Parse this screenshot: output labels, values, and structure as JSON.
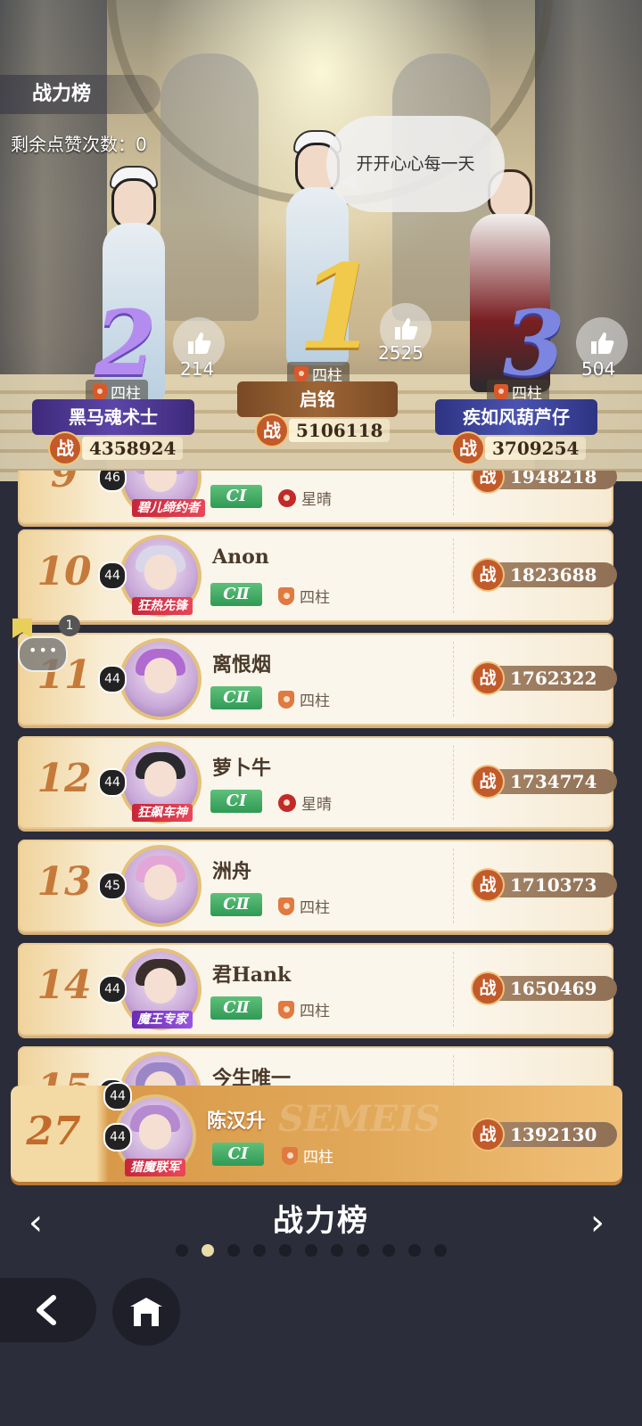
{
  "header": {
    "title": "战力榜",
    "likes_remaining": "剩余点赞次数：0"
  },
  "top3": [
    {
      "rank": "1",
      "name": "启铭",
      "guild": "四柱",
      "power": "5106118",
      "likes": "2525",
      "speech": "开开心心每一天"
    },
    {
      "rank": "2",
      "name": "黑马魂术士",
      "guild": "四柱",
      "power": "4358924",
      "likes": "214"
    },
    {
      "rank": "3",
      "name": "疾如风葫芦仔",
      "guild": "四柱",
      "power": "3709254",
      "likes": "504"
    }
  ],
  "power_glyph": "战",
  "list": [
    {
      "rank": "9",
      "level": "46",
      "title": "碧儿缔约者",
      "tier": "CⅠ",
      "guild": "星晴",
      "guild_icon": "fire-icon",
      "power": "1948218",
      "name": ""
    },
    {
      "rank": "10",
      "level": "44",
      "title": "狂热先锋",
      "name": "Anon",
      "tier": "CⅡ",
      "guild": "四柱",
      "guild_icon": "shield-icon",
      "power": "1823688"
    },
    {
      "rank": "11",
      "level": "44",
      "title": "",
      "name": "离恨烟",
      "tier": "CⅡ",
      "guild": "四柱",
      "guild_icon": "shield-icon",
      "power": "1762322"
    },
    {
      "rank": "12",
      "level": "44",
      "title": "狂飙车神",
      "name": "萝卜牛",
      "tier": "CⅠ",
      "guild": "星晴",
      "guild_icon": "fire-icon",
      "power": "1734774"
    },
    {
      "rank": "13",
      "level": "45",
      "title": "",
      "name": "洲舟",
      "tier": "CⅡ",
      "guild": "四柱",
      "guild_icon": "shield-icon",
      "power": "1710373"
    },
    {
      "rank": "14",
      "level": "44",
      "title": "魔王专家",
      "name": "君Hank",
      "tier": "CⅡ",
      "guild": "四柱",
      "guild_icon": "shield-icon",
      "power": "1650469"
    },
    {
      "rank": "15",
      "level": "44",
      "title": "",
      "name": "今生唯一",
      "tier": "",
      "guild": "",
      "guild_icon": "",
      "power": ""
    }
  ],
  "self": {
    "rank": "27",
    "level": "44",
    "title": "猎魔联军",
    "name": "陈汉升",
    "tier": "CⅠ",
    "guild": "四柱",
    "power": "1392130",
    "watermark": "SEMEIS"
  },
  "footer": {
    "title": "战力榜",
    "page_dots": 11,
    "active_dot": 1
  },
  "chat": {
    "unread": "1"
  },
  "colors": {
    "accent_orange": "#c25a2a",
    "tier_green": "#2f9a55",
    "gold": "#f1c94b"
  }
}
